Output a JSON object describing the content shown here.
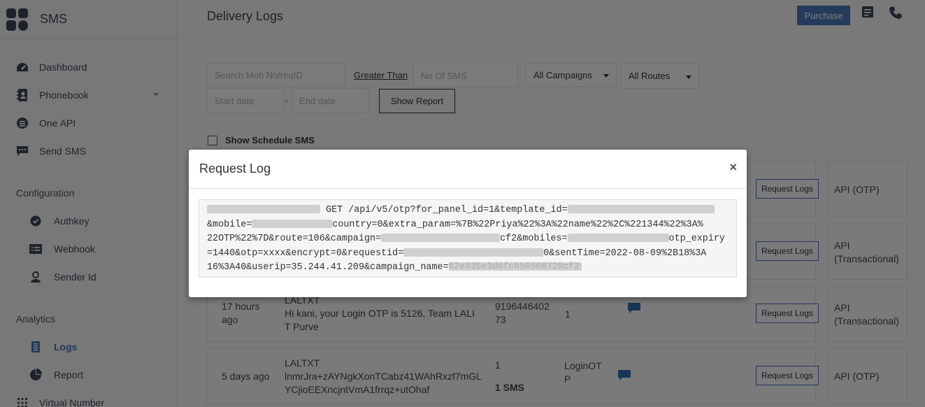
{
  "app": {
    "name": "SMS"
  },
  "sidebar": {
    "top_items": [
      {
        "label": "Dashboard",
        "icon": "dashboard-icon"
      },
      {
        "label": "Phonebook",
        "icon": "phonebook-icon"
      },
      {
        "label": "One API",
        "icon": "one-api-icon"
      },
      {
        "label": "Send SMS",
        "icon": "send-sms-icon"
      }
    ],
    "sections": {
      "configuration": "Configuration",
      "analytics": "Analytics"
    },
    "config_items": [
      {
        "label": "Authkey",
        "icon": "check-badge-icon"
      },
      {
        "label": "Webhook",
        "icon": "webhook-icon"
      },
      {
        "label": "Sender Id",
        "icon": "user-icon"
      }
    ],
    "analytics_items": [
      {
        "label": "Logs",
        "icon": "logs-icon",
        "active": true
      },
      {
        "label": "Report",
        "icon": "pie-chart-icon"
      },
      {
        "label": "Virtual Number",
        "icon": "grid-icon"
      }
    ]
  },
  "header": {
    "title": "Delivery Logs",
    "purchase_label": "Purchase"
  },
  "filters": {
    "search_placeholder": "Search Mob No/reqID",
    "greater_than": "Greater Than",
    "sms_count_placeholder": "No Of SMS",
    "campaign_value": "All Campaigns",
    "route_value": "All Routes",
    "start_placeholder": "Start date",
    "end_placeholder": "End date",
    "date_separator": "-",
    "show_report_label": "Show Report",
    "schedule_label": "Show Schedule SMS"
  },
  "rows": [
    {
      "button": "Request Logs",
      "source": "API (OTP)"
    },
    {
      "button": "Request Logs",
      "source": "API (Transactional)"
    },
    {
      "time": "17 hours ago",
      "sender": "LALTXT",
      "message": "Hi kani, your Login OTP is 5126, Team LALIT Purve",
      "mobile": "919644640273",
      "count": "1",
      "button": "Request Logs",
      "source": "API (Transactional)"
    },
    {
      "time": "5 days ago",
      "sender": "LALTXT",
      "message": "lnmrJra+zAYNgkXonTCabz41WAhRxzf7mGLYCjioEEXncjntVmA1frrqz+utOhaf",
      "count": "1",
      "sms_total": "1 SMS",
      "campaign": "LoginOTP",
      "button": "Request Logs",
      "source": "API (OTP)"
    }
  ],
  "modal": {
    "title": "Request Log",
    "close_symbol": "×",
    "log_line1_visible": "GET /api/v5/otp?for_panel_id=1&template_id=",
    "log_line2_tail": "country=0&extra_param=%7B%22Priya%22%3A%22name%22%2C%221344%22%3A%",
    "log_line2_prefix": "&mobile=",
    "log_line3": "22OTP%22%7D&route=106&campaign=",
    "log_line3_mid": "cf2&mobiles=",
    "log_line3_tail": "otp_expiry",
    "log_line4a": "=1440&otp=xxxx&encrypt=0&requestid=",
    "log_line4b": "0&sentTime=2022-08-09%2B18%3A",
    "log_line5a": "16%3A40&userip=35.244.41.209&campaign_name=",
    "log_line5_hidden": "62e835e3d6fc050568729cf2"
  },
  "colors": {
    "accent": "#4a76b8",
    "active_nav": "#4a6fb5",
    "chat_icon": "#2f6db5"
  }
}
